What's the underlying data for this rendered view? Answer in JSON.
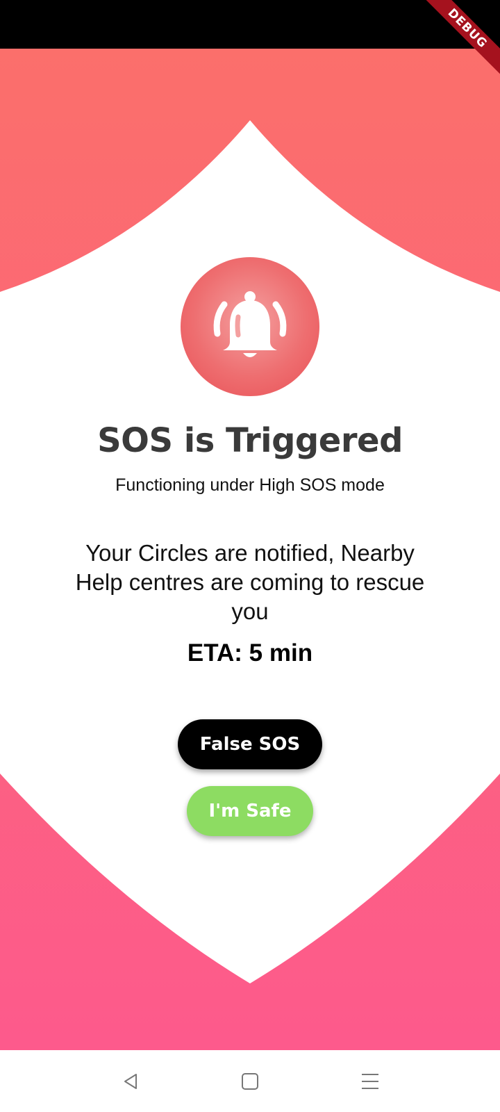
{
  "status_bar": {
    "debug_label": "DEBUG"
  },
  "header": {
    "title": "SOS is Triggered",
    "subtitle": "Functioning under High SOS mode"
  },
  "main": {
    "notice": "Your Circles are notified, Nearby Help centres are coming to rescue you",
    "eta": "ETA: 5 min",
    "alarm_icon": "alarm-bell-icon"
  },
  "actions": {
    "false_sos_label": "False SOS",
    "safe_label": "I'm Safe"
  },
  "nav": {
    "back_icon": "back-icon",
    "home_icon": "home-icon",
    "menu_icon": "menu-icon"
  },
  "colors": {
    "top_gradient_start": "#fb6f6b",
    "bottom_gradient_end": "#fd5a8c",
    "alarm_circle": "#ee6e70",
    "false_button": "#000000",
    "safe_button": "#8ddc62"
  }
}
